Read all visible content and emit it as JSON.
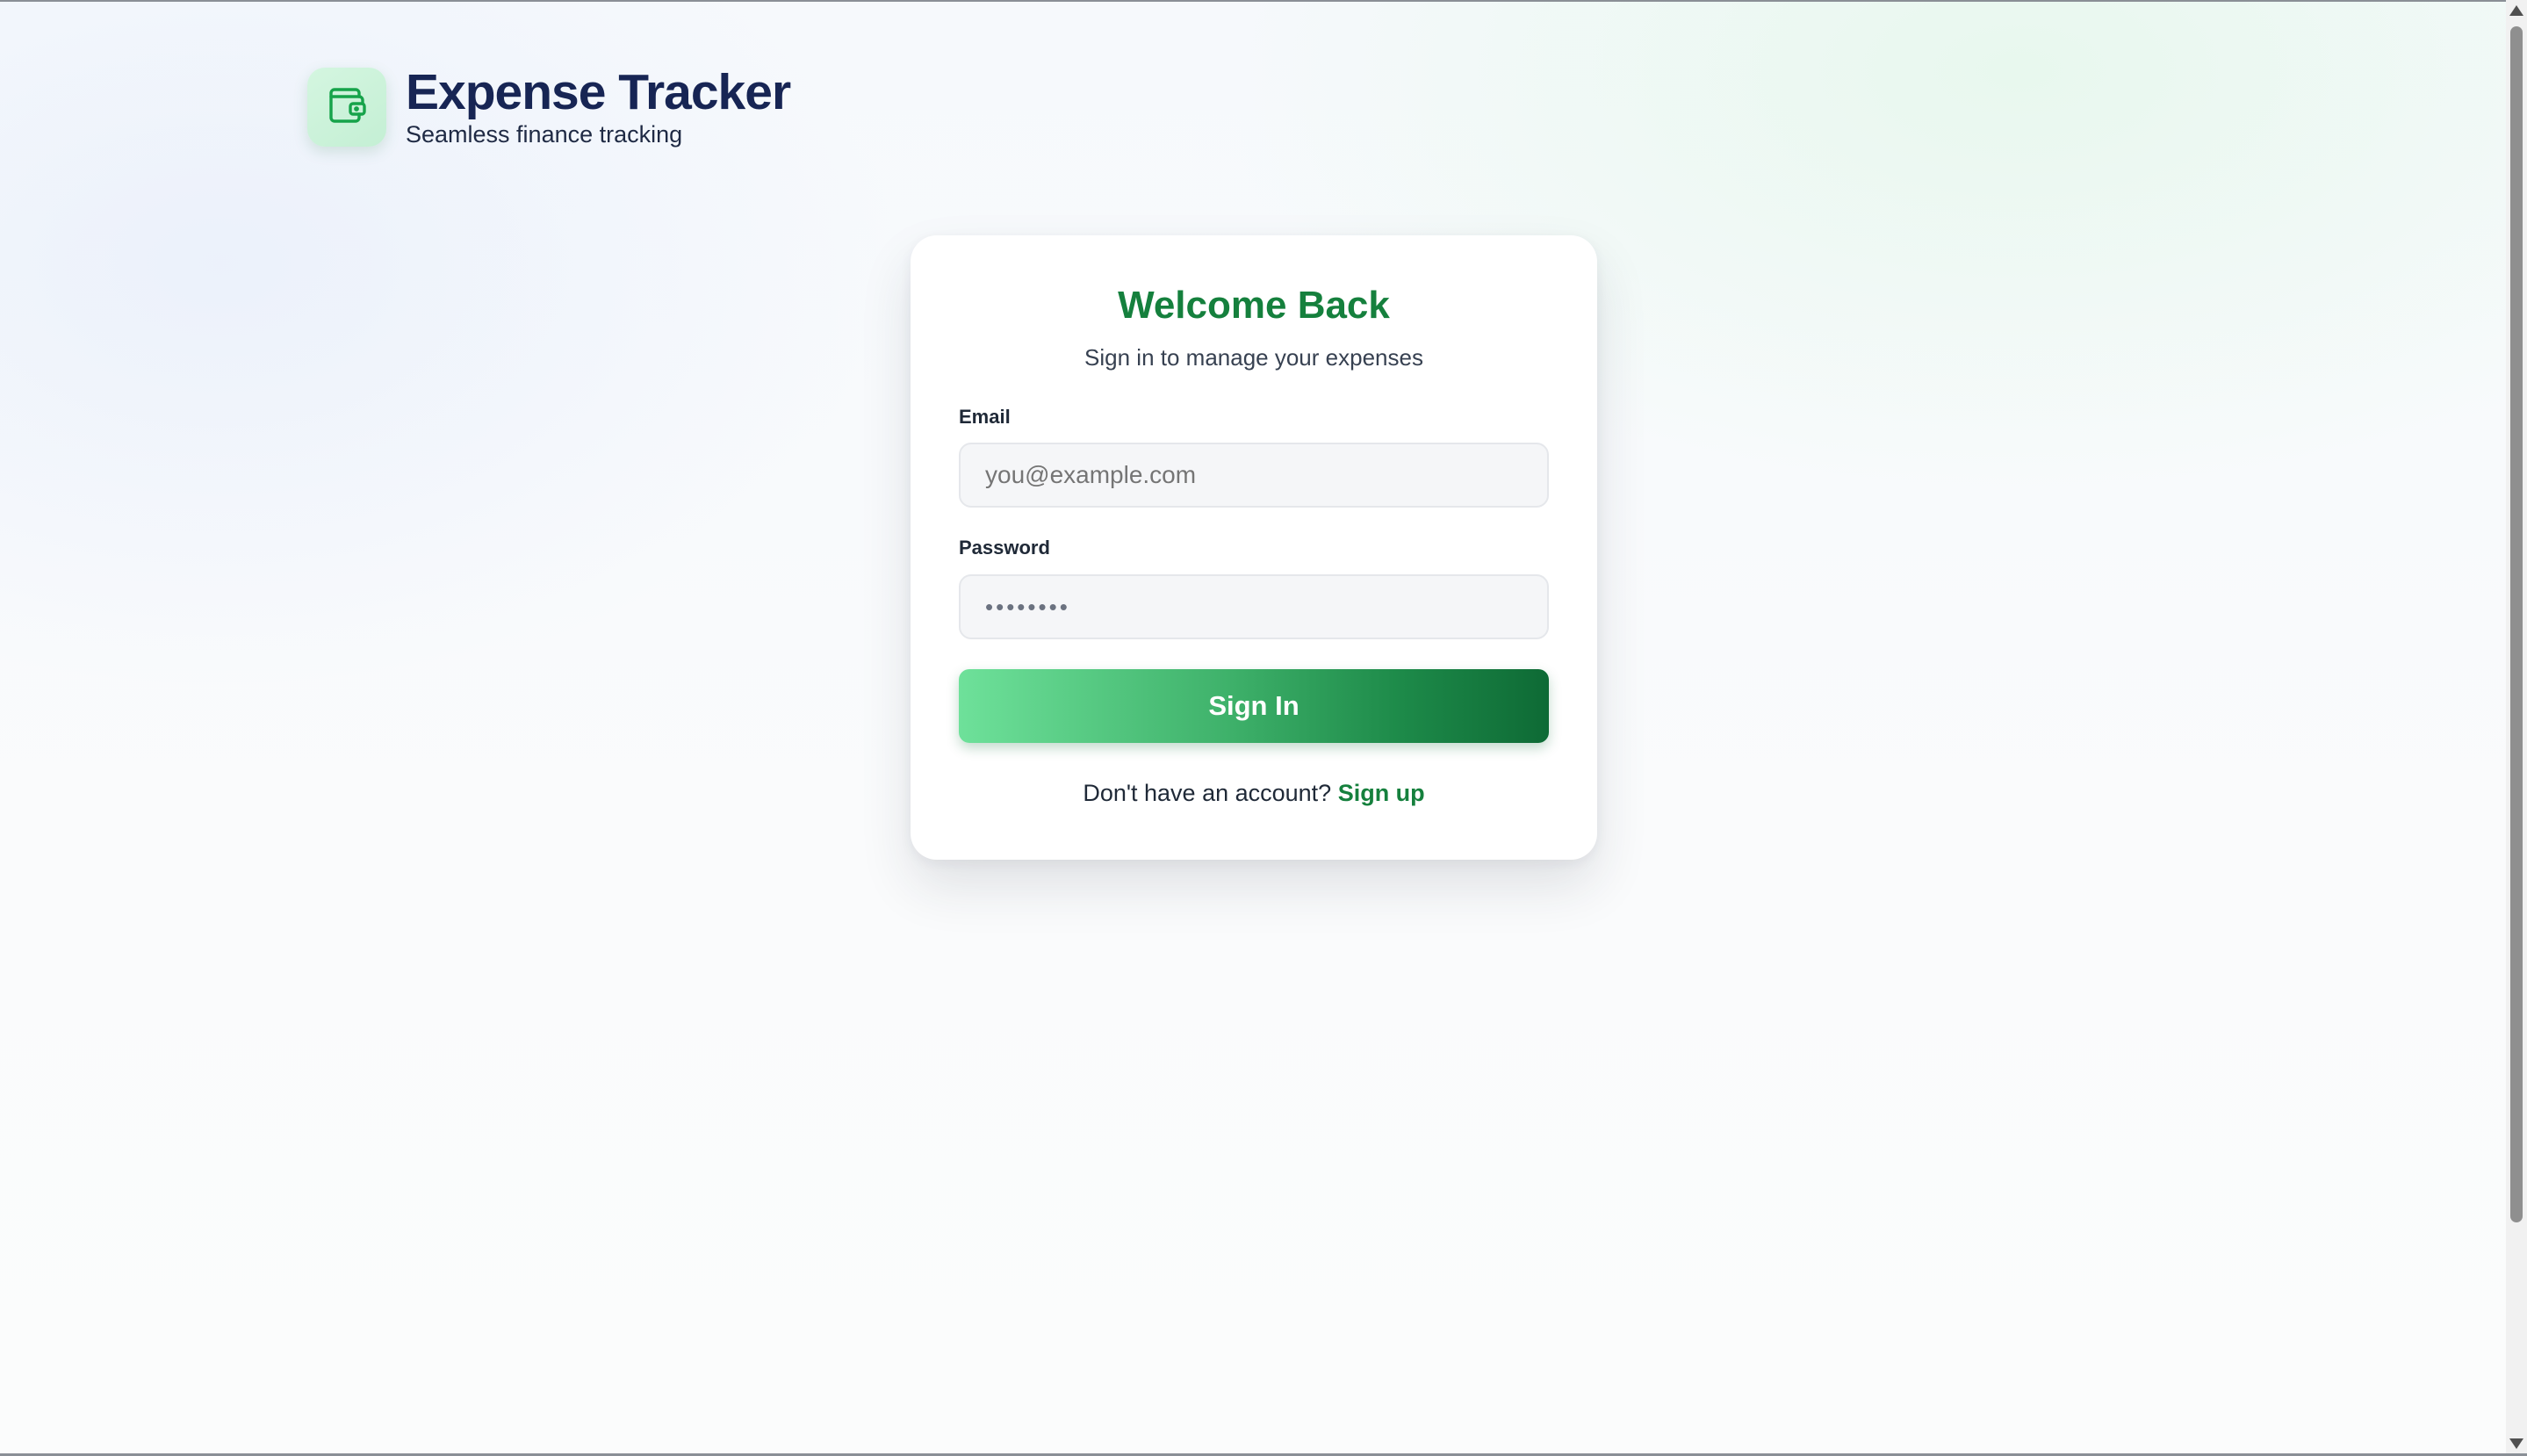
{
  "app": {
    "title": "Expense Tracker",
    "subtitle": "Seamless finance tracking",
    "logo_icon": "wallet-icon"
  },
  "login": {
    "title": "Welcome Back",
    "subtitle": "Sign in to manage your expenses",
    "email_label": "Email",
    "email_placeholder": "you@example.com",
    "email_value": "",
    "password_label": "Password",
    "password_value": "••••••••",
    "submit_label": "Sign In",
    "signup_prompt": "Don't have an account?",
    "signup_link": "Sign up"
  },
  "colors": {
    "accent": "#15803d",
    "brand_title": "#172554",
    "button_gradient_start": "#6ee19a",
    "button_gradient_end": "#0e6a35"
  }
}
